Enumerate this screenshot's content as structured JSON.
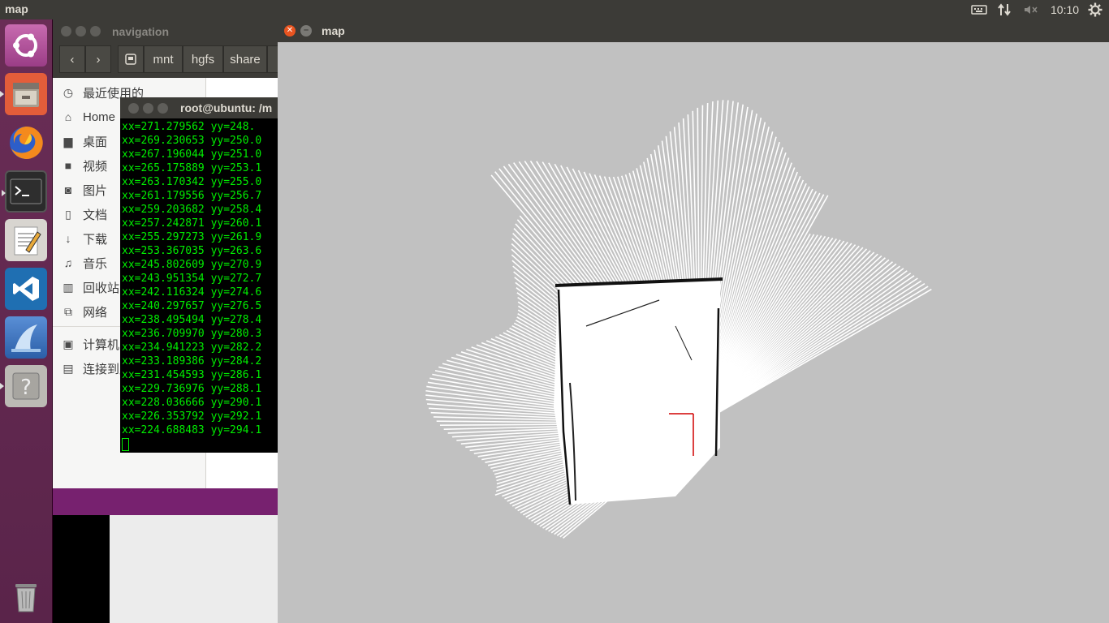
{
  "top_panel": {
    "app_title": "map",
    "clock": "10:10",
    "icons": [
      "keyboard-icon",
      "network-icon",
      "volume-muted-icon",
      "settings-gear-icon"
    ]
  },
  "launcher": {
    "items": [
      "ubuntu-dash",
      "files",
      "firefox",
      "terminal",
      "text-editor",
      "vscode",
      "wireshark",
      "help",
      "trash"
    ]
  },
  "files_window": {
    "title": "navigation",
    "path": [
      "mnt",
      "hgfs",
      "share"
    ],
    "sidebar": [
      {
        "icon": "clock-icon",
        "label": "最近使用的"
      },
      {
        "icon": "home-icon",
        "label": "Home"
      },
      {
        "icon": "folder-icon",
        "label": "桌面"
      },
      {
        "icon": "video-icon",
        "label": "视频"
      },
      {
        "icon": "camera-icon",
        "label": "图片"
      },
      {
        "icon": "document-icon",
        "label": "文档"
      },
      {
        "icon": "download-icon",
        "label": "下载"
      },
      {
        "icon": "music-icon",
        "label": "音乐"
      },
      {
        "icon": "trash-icon",
        "label": "回收站"
      },
      {
        "icon": "network-icon",
        "label": "网络"
      },
      {
        "icon": "computer-icon",
        "label": "计算机"
      },
      {
        "icon": "server-icon",
        "label": "连接到服务器"
      }
    ]
  },
  "terminal": {
    "title": "root@ubuntu: /m",
    "lines": [
      "xx=271.279562 yy=248.",
      "xx=269.230653 yy=250.0",
      "xx=267.196044 yy=251.0",
      "xx=265.175889 yy=253.1",
      "xx=263.170342 yy=255.0",
      "xx=261.179556 yy=256.7",
      "xx=259.203682 yy=258.4",
      "xx=257.242871 yy=260.1",
      "xx=255.297273 yy=261.9",
      "xx=253.367035 yy=263.6",
      "xx=245.802609 yy=270.9",
      "xx=243.951354 yy=272.7",
      "xx=242.116324 yy=274.6",
      "xx=240.297657 yy=276.5",
      "xx=238.495494 yy=278.4",
      "xx=236.709970 yy=280.3",
      "xx=234.941223 yy=282.2",
      "xx=233.189386 yy=284.2",
      "xx=231.454593 yy=286.1",
      "xx=229.736976 yy=288.1",
      "xx=228.036666 yy=290.1",
      "xx=226.353792 yy=292.1",
      "xx=224.688483 yy=294.1"
    ]
  },
  "map_window": {
    "title": "map"
  },
  "colors": {
    "panel": "#3c3b37",
    "launcher": "#5e2750",
    "terminal_text": "#00ee00",
    "map_background": "#c1c1c1",
    "accent": "#e95420"
  }
}
